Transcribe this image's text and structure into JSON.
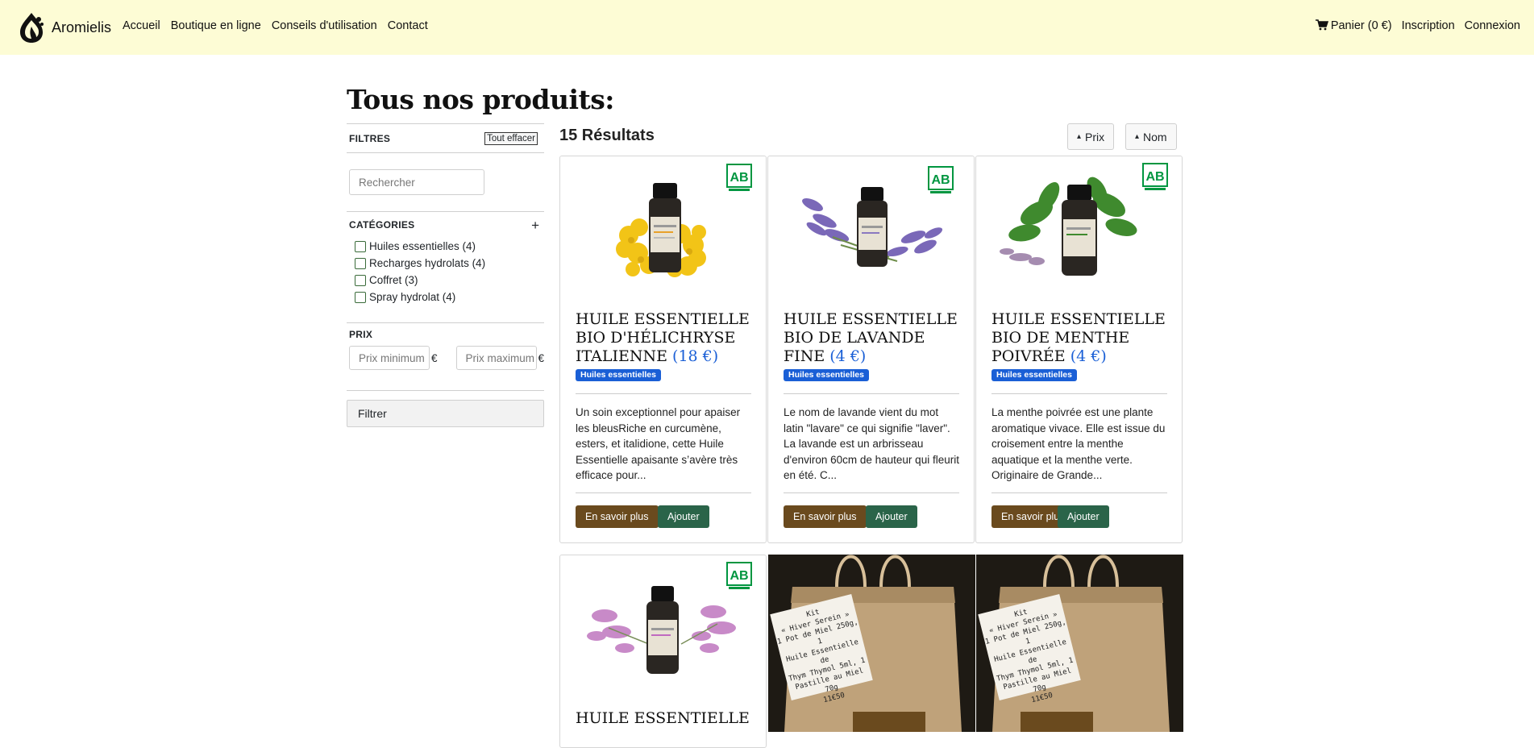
{
  "navbar": {
    "brand": "Aromielis",
    "left_links": [
      "Accueil",
      "Boutique en ligne",
      "Conseils d'utilisation",
      "Contact"
    ],
    "cart": "Panier (0 €)",
    "signup": "Inscription",
    "login": "Connexion",
    "bg_color": "#fdfcd5"
  },
  "page": {
    "title": "Tous nos produits:"
  },
  "filters": {
    "title": "FILTRES",
    "clear": "Tout effacer",
    "search_placeholder": "Rechercher",
    "categories_title": "CATÉGORIES",
    "categories": [
      "Huiles essentielles (4)",
      "Recharges hydrolats (4)",
      "Coffret (3)",
      "Spray hydrolat (4)"
    ],
    "price_title": "PRIX",
    "price_min_placeholder": "Prix minimum",
    "price_max_placeholder": "Prix maximum",
    "currency": "€",
    "filter_button": "Filtrer"
  },
  "results": {
    "count_label": "15 Résultats",
    "sort_price": "Prix",
    "sort_name": "Nom"
  },
  "products": [
    {
      "title": "HUILE ESSENTIELLE BIO D'Hélichryse ITALIENNE",
      "price": "(18 €)",
      "category": "Huiles essentielles",
      "description": "Un soin exceptionnel pour apaiser les bleusRiche en curcumène, esters, et italidione, cette Huile Essentielle apaisante s’avère très efficace pour...",
      "more": "En savoir plus",
      "add": "Ajouter"
    },
    {
      "title": "HUILE ESSENTIELLE BIO DE LAVANDE FINE",
      "price": "(4 €)",
      "category": "Huiles essentielles",
      "description": "Le nom de lavande vient du mot latin \"lavare\" ce qui signifie \"laver\". La lavande est un arbrisseau d'environ 60cm de hauteur qui fleurit en été. C...",
      "more": "En savoir plus",
      "add": "Ajouter"
    },
    {
      "title": "HUILE ESSENTIELLE BIO DE MENTHE POIVRée",
      "price": "(4 €)",
      "category": "Huiles essentielles",
      "description": "La menthe poivrée est une plante aromatique vivace. Elle est issue du croisement entre la menthe aquatique et la menthe verte. Originaire de Grande...",
      "more": "En savoir plus",
      "add": "Ajouter"
    },
    {
      "title": "HUILE ESSENTIELLE"
    }
  ],
  "kit_label": {
    "line1": "Kit",
    "line2": "« Hiver Serein »",
    "line3": "1 Pot de Miel 250g, 1",
    "line4": "Huile Essentielle de",
    "line5": "Thym Thymol 5ml, 1",
    "line6": "Pastille au Miel 70g",
    "line7": "11€50"
  },
  "colors": {
    "price_blue": "#1a5fd6",
    "more_button": "#6a4a1e",
    "add_button": "#2a6449"
  }
}
